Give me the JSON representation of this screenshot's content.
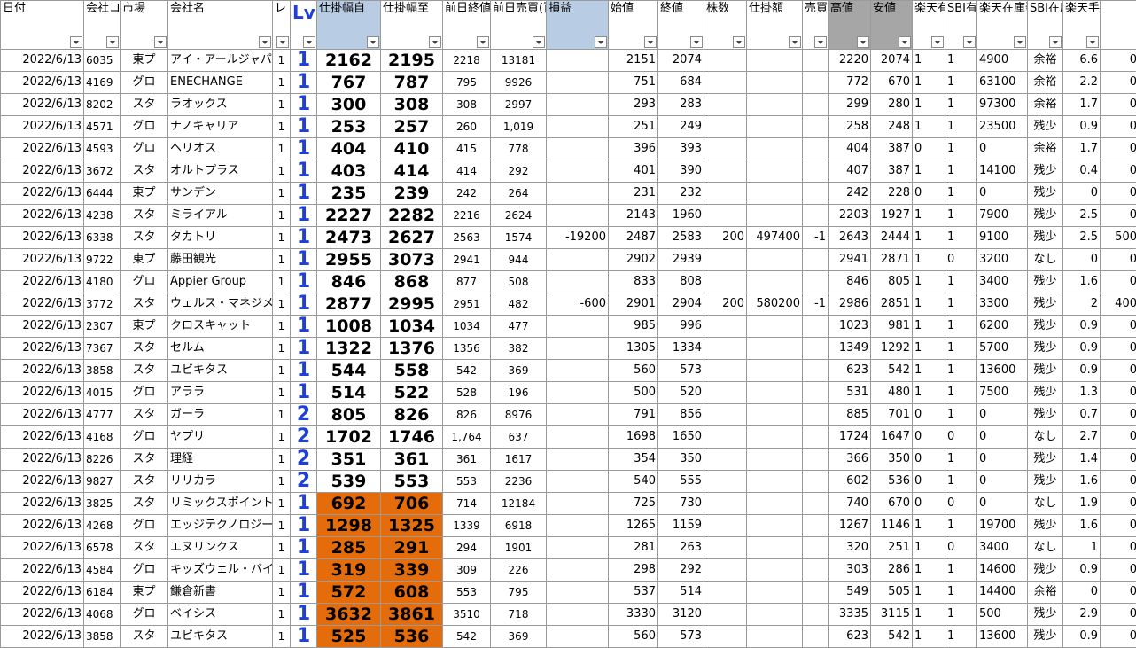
{
  "headers": [
    {
      "label": "日付",
      "style": ""
    },
    {
      "label": "会社コード",
      "style": ""
    },
    {
      "label": "市場",
      "style": ""
    },
    {
      "label": "会社名",
      "style": ""
    },
    {
      "label": "レ",
      "style": ""
    },
    {
      "label": "Lv",
      "style": "lv"
    },
    {
      "label": "仕掛幅自",
      "style": "blue"
    },
    {
      "label": "仕掛幅至",
      "style": ""
    },
    {
      "label": "前日終値",
      "style": ""
    },
    {
      "label": "前日売買(百万円)",
      "style": ""
    },
    {
      "label": "損益",
      "style": "blue"
    },
    {
      "label": "始値",
      "style": ""
    },
    {
      "label": "終値",
      "style": ""
    },
    {
      "label": "株数",
      "style": ""
    },
    {
      "label": "仕掛額",
      "style": ""
    },
    {
      "label": "売買",
      "style": ""
    },
    {
      "label": "高値",
      "style": "gray"
    },
    {
      "label": "安値",
      "style": "gray"
    },
    {
      "label": "楽天有無",
      "style": ""
    },
    {
      "label": "SBI有無",
      "style": ""
    },
    {
      "label": "楽天在庫数",
      "style": ""
    },
    {
      "label": "SBI在庫数",
      "style": ""
    },
    {
      "label": "楽天手数料",
      "style": ""
    },
    {
      "label": "",
      "style": ""
    }
  ],
  "rows": [
    {
      "date": "2022/6/13",
      "code": "6035",
      "market": "東プ",
      "name": "アイ・アールジャパ",
      "re": "1",
      "lv": "1",
      "from": "2162",
      "to": "2195",
      "prev_close": "2218",
      "prev_vol": "13181",
      "pnl": "",
      "open": "2151",
      "close": "2074",
      "shares": "",
      "amount": "",
      "side": "",
      "high": "2220",
      "low": "2074",
      "rak": "1",
      "sbi": "1",
      "rak_stock": "4900",
      "sbi_stock": "余裕",
      "fee": "6.6",
      "last": "0",
      "hl": false
    },
    {
      "date": "2022/6/13",
      "code": "4169",
      "market": "グロ",
      "name": "ENECHANGE",
      "re": "1",
      "lv": "1",
      "from": "767",
      "to": "787",
      "prev_close": "795",
      "prev_vol": "9926",
      "pnl": "",
      "open": "751",
      "close": "684",
      "shares": "",
      "amount": "",
      "side": "",
      "high": "772",
      "low": "670",
      "rak": "1",
      "sbi": "1",
      "rak_stock": "63100",
      "sbi_stock": "余裕",
      "fee": "2.2",
      "last": "0",
      "hl": false
    },
    {
      "date": "2022/6/13",
      "code": "8202",
      "market": "スタ",
      "name": "ラオックス",
      "re": "1",
      "lv": "1",
      "from": "300",
      "to": "308",
      "prev_close": "308",
      "prev_vol": "2997",
      "pnl": "",
      "open": "293",
      "close": "283",
      "shares": "",
      "amount": "",
      "side": "",
      "high": "299",
      "low": "280",
      "rak": "1",
      "sbi": "1",
      "rak_stock": "97300",
      "sbi_stock": "余裕",
      "fee": "1.7",
      "last": "0",
      "hl": false
    },
    {
      "date": "2022/6/13",
      "code": "4571",
      "market": "グロ",
      "name": "ナノキャリア",
      "re": "1",
      "lv": "1",
      "from": "253",
      "to": "257",
      "prev_close": "260",
      "prev_vol": "1,019",
      "pnl": "",
      "open": "251",
      "close": "249",
      "shares": "",
      "amount": "",
      "side": "",
      "high": "258",
      "low": "248",
      "rak": "1",
      "sbi": "1",
      "rak_stock": "23500",
      "sbi_stock": "残少",
      "fee": "0.9",
      "last": "0",
      "hl": false
    },
    {
      "date": "2022/6/13",
      "code": "4593",
      "market": "グロ",
      "name": "ヘリオス",
      "re": "1",
      "lv": "1",
      "from": "404",
      "to": "410",
      "prev_close": "415",
      "prev_vol": "778",
      "pnl": "",
      "open": "396",
      "close": "393",
      "shares": "",
      "amount": "",
      "side": "",
      "high": "404",
      "low": "387",
      "rak": "0",
      "sbi": "1",
      "rak_stock": "0",
      "sbi_stock": "余裕",
      "fee": "1.7",
      "last": "0",
      "hl": false
    },
    {
      "date": "2022/6/13",
      "code": "3672",
      "market": "スタ",
      "name": "オルトプラス",
      "re": "1",
      "lv": "1",
      "from": "403",
      "to": "414",
      "prev_close": "414",
      "prev_vol": "292",
      "pnl": "",
      "open": "401",
      "close": "390",
      "shares": "",
      "amount": "",
      "side": "",
      "high": "407",
      "low": "387",
      "rak": "1",
      "sbi": "1",
      "rak_stock": "14100",
      "sbi_stock": "残少",
      "fee": "0.4",
      "last": "0",
      "hl": false
    },
    {
      "date": "2022/6/13",
      "code": "6444",
      "market": "東プ",
      "name": "サンデン",
      "re": "1",
      "lv": "1",
      "from": "235",
      "to": "239",
      "prev_close": "242",
      "prev_vol": "264",
      "pnl": "",
      "open": "231",
      "close": "232",
      "shares": "",
      "amount": "",
      "side": "",
      "high": "242",
      "low": "228",
      "rak": "0",
      "sbi": "1",
      "rak_stock": "0",
      "sbi_stock": "残少",
      "fee": "0",
      "last": "0",
      "hl": false
    },
    {
      "date": "2022/6/13",
      "code": "4238",
      "market": "スタ",
      "name": "ミライアル",
      "re": "1",
      "lv": "1",
      "from": "2227",
      "to": "2282",
      "prev_close": "2216",
      "prev_vol": "2624",
      "pnl": "",
      "open": "2143",
      "close": "1960",
      "shares": "",
      "amount": "",
      "side": "",
      "high": "2203",
      "low": "1927",
      "rak": "1",
      "sbi": "1",
      "rak_stock": "7900",
      "sbi_stock": "残少",
      "fee": "2.5",
      "last": "0",
      "hl": false
    },
    {
      "date": "2022/6/13",
      "code": "6338",
      "market": "スタ",
      "name": "タカトリ",
      "re": "1",
      "lv": "1",
      "from": "2473",
      "to": "2627",
      "prev_close": "2563",
      "prev_vol": "1574",
      "pnl": "-19200",
      "open": "2487",
      "close": "2583",
      "shares": "200",
      "amount": "497400",
      "side": "-1",
      "high": "2643",
      "low": "2444",
      "rak": "1",
      "sbi": "1",
      "rak_stock": "9100",
      "sbi_stock": "残少",
      "fee": "2.5",
      "last": "500",
      "hl": false
    },
    {
      "date": "2022/6/13",
      "code": "9722",
      "market": "東プ",
      "name": "藤田観光",
      "re": "1",
      "lv": "1",
      "from": "2955",
      "to": "3073",
      "prev_close": "2941",
      "prev_vol": "944",
      "pnl": "",
      "open": "2902",
      "close": "2939",
      "shares": "",
      "amount": "",
      "side": "",
      "high": "2941",
      "low": "2871",
      "rak": "1",
      "sbi": "0",
      "rak_stock": "3200",
      "sbi_stock": "なし",
      "fee": "0",
      "last": "0",
      "hl": false
    },
    {
      "date": "2022/6/13",
      "code": "4180",
      "market": "グロ",
      "name": "Appier Group",
      "re": "1",
      "lv": "1",
      "from": "846",
      "to": "868",
      "prev_close": "877",
      "prev_vol": "508",
      "pnl": "",
      "open": "833",
      "close": "808",
      "shares": "",
      "amount": "",
      "side": "",
      "high": "846",
      "low": "805",
      "rak": "1",
      "sbi": "1",
      "rak_stock": "3400",
      "sbi_stock": "残少",
      "fee": "1.6",
      "last": "0",
      "hl": false
    },
    {
      "date": "2022/6/13",
      "code": "3772",
      "market": "スタ",
      "name": "ウェルス・マネジメ",
      "re": "1",
      "lv": "1",
      "from": "2877",
      "to": "2995",
      "prev_close": "2951",
      "prev_vol": "482",
      "pnl": "-600",
      "open": "2901",
      "close": "2904",
      "shares": "200",
      "amount": "580200",
      "side": "-1",
      "high": "2986",
      "low": "2851",
      "rak": "1",
      "sbi": "1",
      "rak_stock": "3300",
      "sbi_stock": "残少",
      "fee": "2",
      "last": "400",
      "hl": false
    },
    {
      "date": "2022/6/13",
      "code": "2307",
      "market": "東プ",
      "name": "クロスキャット",
      "re": "1",
      "lv": "1",
      "from": "1008",
      "to": "1034",
      "prev_close": "1034",
      "prev_vol": "477",
      "pnl": "",
      "open": "985",
      "close": "996",
      "shares": "",
      "amount": "",
      "side": "",
      "high": "1023",
      "low": "981",
      "rak": "1",
      "sbi": "1",
      "rak_stock": "6200",
      "sbi_stock": "残少",
      "fee": "0.9",
      "last": "0",
      "hl": false
    },
    {
      "date": "2022/6/13",
      "code": "7367",
      "market": "スタ",
      "name": "セルム",
      "re": "1",
      "lv": "1",
      "from": "1322",
      "to": "1376",
      "prev_close": "1356",
      "prev_vol": "382",
      "pnl": "",
      "open": "1305",
      "close": "1334",
      "shares": "",
      "amount": "",
      "side": "",
      "high": "1349",
      "low": "1292",
      "rak": "1",
      "sbi": "1",
      "rak_stock": "5700",
      "sbi_stock": "残少",
      "fee": "0.9",
      "last": "0",
      "hl": false
    },
    {
      "date": "2022/6/13",
      "code": "3858",
      "market": "スタ",
      "name": "ユビキタス",
      "re": "1",
      "lv": "1",
      "from": "544",
      "to": "558",
      "prev_close": "542",
      "prev_vol": "369",
      "pnl": "",
      "open": "560",
      "close": "573",
      "shares": "",
      "amount": "",
      "side": "",
      "high": "623",
      "low": "542",
      "rak": "1",
      "sbi": "1",
      "rak_stock": "13600",
      "sbi_stock": "残少",
      "fee": "0.9",
      "last": "0",
      "hl": false
    },
    {
      "date": "2022/6/13",
      "code": "4015",
      "market": "グロ",
      "name": "アララ",
      "re": "1",
      "lv": "1",
      "from": "514",
      "to": "522",
      "prev_close": "528",
      "prev_vol": "196",
      "pnl": "",
      "open": "500",
      "close": "520",
      "shares": "",
      "amount": "",
      "side": "",
      "high": "531",
      "low": "480",
      "rak": "1",
      "sbi": "1",
      "rak_stock": "7500",
      "sbi_stock": "残少",
      "fee": "1.3",
      "last": "0",
      "hl": false
    },
    {
      "date": "2022/6/13",
      "code": "4777",
      "market": "スタ",
      "name": "ガーラ",
      "re": "1",
      "lv": "2",
      "from": "805",
      "to": "826",
      "prev_close": "826",
      "prev_vol": "8976",
      "pnl": "",
      "open": "791",
      "close": "856",
      "shares": "",
      "amount": "",
      "side": "",
      "high": "885",
      "low": "701",
      "rak": "0",
      "sbi": "1",
      "rak_stock": "0",
      "sbi_stock": "残少",
      "fee": "0.7",
      "last": "0",
      "hl": false
    },
    {
      "date": "2022/6/13",
      "code": "4168",
      "market": "グロ",
      "name": "ヤプリ",
      "re": "1",
      "lv": "2",
      "from": "1702",
      "to": "1746",
      "prev_close": "1,764",
      "prev_vol": "637",
      "pnl": "",
      "open": "1698",
      "close": "1650",
      "shares": "",
      "amount": "",
      "side": "",
      "high": "1724",
      "low": "1647",
      "rak": "0",
      "sbi": "0",
      "rak_stock": "0",
      "sbi_stock": "なし",
      "fee": "2.7",
      "last": "0",
      "hl": false
    },
    {
      "date": "2022/6/13",
      "code": "8226",
      "market": "スタ",
      "name": "理経",
      "re": "1",
      "lv": "2",
      "from": "351",
      "to": "361",
      "prev_close": "361",
      "prev_vol": "1617",
      "pnl": "",
      "open": "354",
      "close": "350",
      "shares": "",
      "amount": "",
      "side": "",
      "high": "366",
      "low": "350",
      "rak": "0",
      "sbi": "1",
      "rak_stock": "0",
      "sbi_stock": "残少",
      "fee": "1.4",
      "last": "0",
      "hl": false
    },
    {
      "date": "2022/6/13",
      "code": "9827",
      "market": "スタ",
      "name": "リリカラ",
      "re": "1",
      "lv": "2",
      "from": "539",
      "to": "553",
      "prev_close": "553",
      "prev_vol": "2236",
      "pnl": "",
      "open": "540",
      "close": "555",
      "shares": "",
      "amount": "",
      "side": "",
      "high": "602",
      "low": "536",
      "rak": "0",
      "sbi": "1",
      "rak_stock": "0",
      "sbi_stock": "残少",
      "fee": "1.6",
      "last": "0",
      "hl": false
    },
    {
      "date": "2022/6/13",
      "code": "3825",
      "market": "スタ",
      "name": "リミックスポイント",
      "re": "1",
      "lv": "1",
      "from": "692",
      "to": "706",
      "prev_close": "714",
      "prev_vol": "12184",
      "pnl": "",
      "open": "725",
      "close": "730",
      "shares": "",
      "amount": "",
      "side": "",
      "high": "740",
      "low": "670",
      "rak": "0",
      "sbi": "0",
      "rak_stock": "0",
      "sbi_stock": "なし",
      "fee": "1.9",
      "last": "0",
      "hl": true
    },
    {
      "date": "2022/6/13",
      "code": "4268",
      "market": "グロ",
      "name": "エッジテクノロジー",
      "re": "1",
      "lv": "1",
      "from": "1298",
      "to": "1325",
      "prev_close": "1339",
      "prev_vol": "6918",
      "pnl": "",
      "open": "1265",
      "close": "1159",
      "shares": "",
      "amount": "",
      "side": "",
      "high": "1267",
      "low": "1146",
      "rak": "1",
      "sbi": "1",
      "rak_stock": "19700",
      "sbi_stock": "残少",
      "fee": "1.6",
      "last": "0",
      "hl": true
    },
    {
      "date": "2022/6/13",
      "code": "6578",
      "market": "スタ",
      "name": "エヌリンクス",
      "re": "1",
      "lv": "1",
      "from": "285",
      "to": "291",
      "prev_close": "294",
      "prev_vol": "1901",
      "pnl": "",
      "open": "281",
      "close": "263",
      "shares": "",
      "amount": "",
      "side": "",
      "high": "320",
      "low": "251",
      "rak": "1",
      "sbi": "0",
      "rak_stock": "3400",
      "sbi_stock": "なし",
      "fee": "1",
      "last": "0",
      "hl": true
    },
    {
      "date": "2022/6/13",
      "code": "4584",
      "market": "グロ",
      "name": "キッズウェル・バイ",
      "re": "1",
      "lv": "1",
      "from": "319",
      "to": "339",
      "prev_close": "309",
      "prev_vol": "226",
      "pnl": "",
      "open": "298",
      "close": "292",
      "shares": "",
      "amount": "",
      "side": "",
      "high": "303",
      "low": "286",
      "rak": "1",
      "sbi": "1",
      "rak_stock": "14600",
      "sbi_stock": "残少",
      "fee": "0.9",
      "last": "0",
      "hl": true
    },
    {
      "date": "2022/6/13",
      "code": "6184",
      "market": "東プ",
      "name": "鎌倉新書",
      "re": "1",
      "lv": "1",
      "from": "572",
      "to": "608",
      "prev_close": "553",
      "prev_vol": "795",
      "pnl": "",
      "open": "537",
      "close": "514",
      "shares": "",
      "amount": "",
      "side": "",
      "high": "549",
      "low": "505",
      "rak": "1",
      "sbi": "1",
      "rak_stock": "14400",
      "sbi_stock": "余裕",
      "fee": "0",
      "last": "0",
      "hl": true
    },
    {
      "date": "2022/6/13",
      "code": "4068",
      "market": "グロ",
      "name": "ベイシス",
      "re": "1",
      "lv": "1",
      "from": "3632",
      "to": "3861",
      "prev_close": "3510",
      "prev_vol": "718",
      "pnl": "",
      "open": "3330",
      "close": "3120",
      "shares": "",
      "amount": "",
      "side": "",
      "high": "3335",
      "low": "3115",
      "rak": "1",
      "sbi": "1",
      "rak_stock": "500",
      "sbi_stock": "残少",
      "fee": "2.9",
      "last": "0",
      "hl": true
    },
    {
      "date": "2022/6/13",
      "code": "3858",
      "market": "スタ",
      "name": "ユビキタス",
      "re": "1",
      "lv": "1",
      "from": "525",
      "to": "536",
      "prev_close": "542",
      "prev_vol": "369",
      "pnl": "",
      "open": "560",
      "close": "573",
      "shares": "",
      "amount": "",
      "side": "",
      "high": "623",
      "low": "542",
      "rak": "1",
      "sbi": "1",
      "rak_stock": "13600",
      "sbi_stock": "残少",
      "fee": "0.9",
      "last": "0",
      "hl": true
    }
  ],
  "colors": {
    "highlight": "#e46c0a",
    "lv": "#1f3fd6",
    "header_blue": "#b8cce4",
    "header_gray": "#a6a6a6"
  }
}
